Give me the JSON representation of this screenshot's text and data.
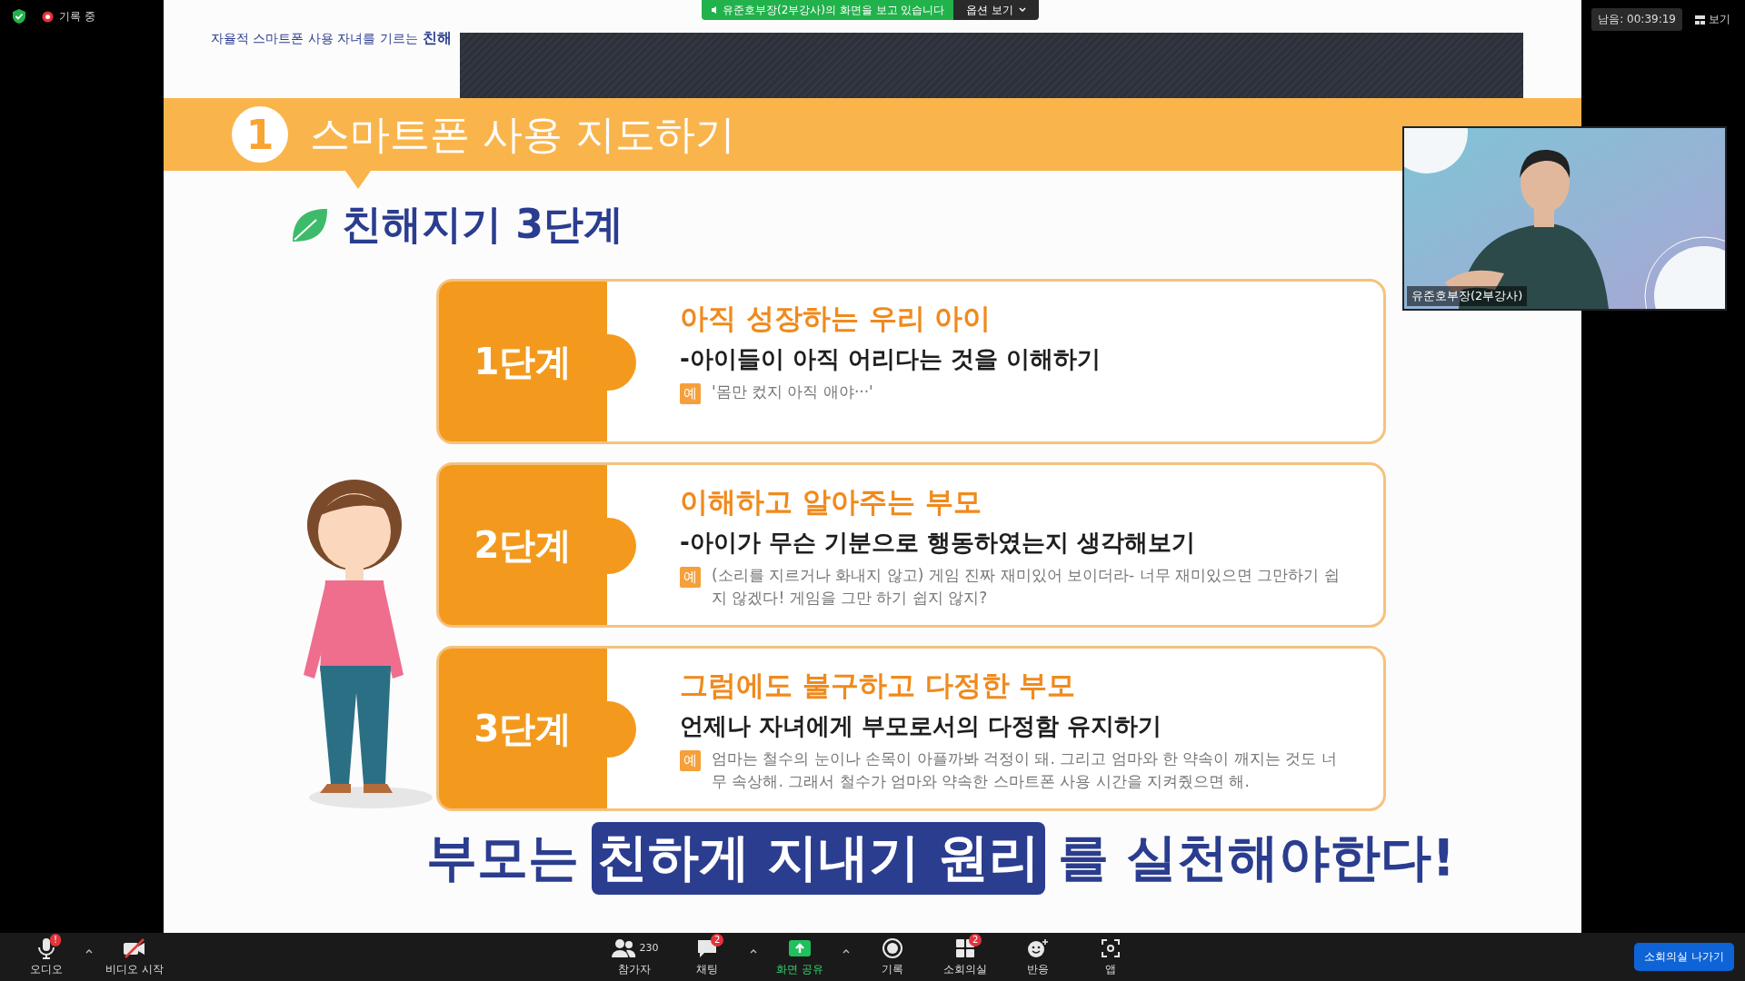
{
  "meeting": {
    "recording_label": "기록 중",
    "viewing_banner": "유준호부장(2부강사)의 화면을 보고 있습니다",
    "view_options": "옵션 보기",
    "time_left": "남음: 00:39:19",
    "view_button": "보기"
  },
  "slide": {
    "header": "자율적 스마트폰 사용 자녀를 기르는",
    "header_bold": "친해",
    "section_number": "1",
    "section_title": "스마트폰 사용 지도하기",
    "heading": "친해지기 3단계",
    "steps": [
      {
        "label": "1단계",
        "title": "아직 성장하는 우리 아이",
        "subtitle": "-아이들이 아직 어리다는 것을 이해하기",
        "example_mark": "예",
        "example": "'몸만 컸지 아직 애야···'"
      },
      {
        "label": "2단계",
        "title": "이해하고 알아주는 부모",
        "subtitle": "-아이가 무슨 기분으로 행동하였는지 생각해보기",
        "example_mark": "예",
        "example": "(소리를 지르거나 화내지 않고) 게임 진짜 재미있어 보이더라- 너무 재미있으면 그만하기 쉽지 않겠다! 게임을 그만 하기 쉽지 않지?"
      },
      {
        "label": "3단계",
        "title": "그럼에도 불구하고 다정한 부모",
        "subtitle": "언제나 자녀에게 부모로서의 다정함 유지하기",
        "example_mark": "예",
        "example": "엄마는 철수의 눈이나 손목이 아플까봐 걱정이 돼. 그리고 엄마와 한 약속이 깨지는 것도 너무 속상해. 그래서 철수가 엄마와 약속한 스마트폰 사용 시간을 지켜줬으면 해."
      }
    ],
    "conclusion": [
      {
        "text": "부모는",
        "highlight": false
      },
      {
        "text": "친하게 지내기 원리",
        "highlight": true
      },
      {
        "text": "를 실천해야한다!",
        "highlight": false
      }
    ]
  },
  "speaker_video": {
    "name": "유준호부장(2부강사)"
  },
  "toolbar": {
    "left": [
      {
        "kind": "audio",
        "label": "오디오",
        "badge": "!",
        "has_menu": true
      },
      {
        "kind": "video",
        "label": "비디오 시작",
        "has_menu": false
      }
    ],
    "center": [
      {
        "kind": "participants",
        "label": "참가자",
        "count": "230",
        "has_menu": false
      },
      {
        "kind": "chat",
        "label": "채팅",
        "badge": "2",
        "has_menu": true
      },
      {
        "kind": "share",
        "label": "화면 공유",
        "has_menu": true
      },
      {
        "kind": "record",
        "label": "기록",
        "has_menu": false
      },
      {
        "kind": "breakout",
        "label": "소회의실",
        "badge": "2",
        "has_menu": false
      },
      {
        "kind": "reactions",
        "label": "반응",
        "has_menu": false
      },
      {
        "kind": "apps",
        "label": "앱",
        "has_menu": false
      }
    ],
    "leave_button": "소회의실 나가기"
  }
}
